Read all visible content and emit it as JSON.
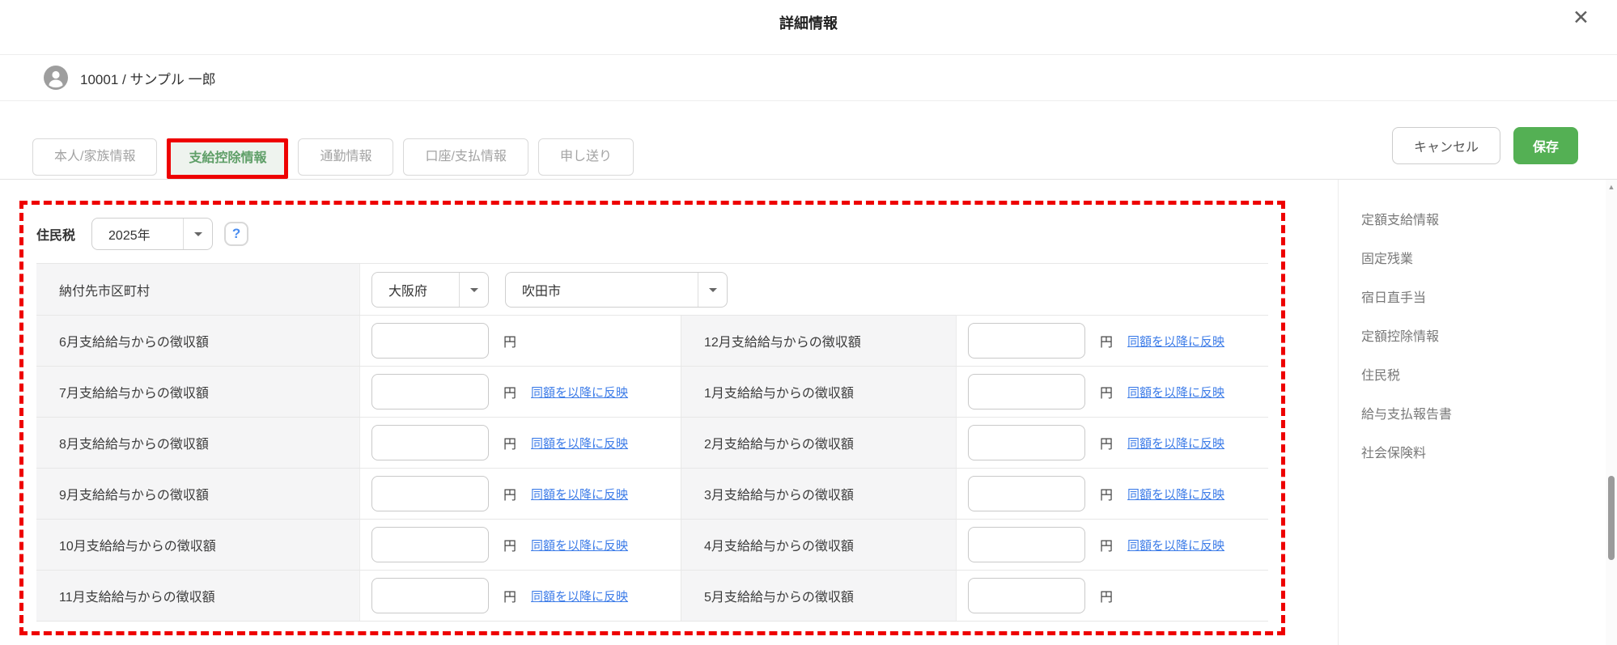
{
  "modal": {
    "title": "詳細情報",
    "close_icon": "✕"
  },
  "employee": {
    "id_name": "10001 / サンプル 一郎"
  },
  "tabs": [
    {
      "label": "本人/家族情報",
      "active": false
    },
    {
      "label": "支給控除情報",
      "active": true
    },
    {
      "label": "通勤情報",
      "active": false
    },
    {
      "label": "口座/支払情報",
      "active": false
    },
    {
      "label": "申し送り",
      "active": false
    }
  ],
  "actions": {
    "cancel_label": "キャンセル",
    "save_label": "保存"
  },
  "resident_tax": {
    "section_label": "住民税",
    "year_value": "2025年",
    "help_label": "?",
    "municipality_label": "納付先市区町村",
    "prefecture_value": "大阪府",
    "city_value": "吹田市",
    "unit": "円",
    "copy_link_label": "同額を以降に反映",
    "rows": [
      {
        "left": "6月支給給与からの徴収額",
        "left_value": "",
        "left_link": false,
        "right": "12月支給給与からの徴収額",
        "right_value": "",
        "right_link": true
      },
      {
        "left": "7月支給給与からの徴収額",
        "left_value": "",
        "left_link": true,
        "right": "1月支給給与からの徴収額",
        "right_value": "",
        "right_link": true
      },
      {
        "left": "8月支給給与からの徴収額",
        "left_value": "",
        "left_link": true,
        "right": "2月支給給与からの徴収額",
        "right_value": "",
        "right_link": true
      },
      {
        "left": "9月支給給与からの徴収額",
        "left_value": "",
        "left_link": true,
        "right": "3月支給給与からの徴収額",
        "right_value": "",
        "right_link": true
      },
      {
        "left": "10月支給給与からの徴収額",
        "left_value": "",
        "left_link": true,
        "right": "4月支給給与からの徴収額",
        "right_value": "",
        "right_link": true
      },
      {
        "left": "11月支給給与からの徴収額",
        "left_value": "",
        "left_link": true,
        "right": "5月支給給与からの徴収額",
        "right_value": "",
        "right_link": false
      }
    ]
  },
  "side_nav": {
    "items": [
      "定額支給情報",
      "固定残業",
      "宿日直手当",
      "定額控除情報",
      "住民税",
      "給与支払報告書",
      "社会保険料"
    ]
  },
  "scrollbar": {
    "up_arrow": "▲"
  },
  "colors": {
    "save_green": "#54b054",
    "active_tab_green": "#5f9f68",
    "active_tab_bg": "#eef3ee",
    "link_blue": "#3d7ce8",
    "annotation_red": "#ee0000",
    "label_cell_bg": "#f5f5f6"
  }
}
